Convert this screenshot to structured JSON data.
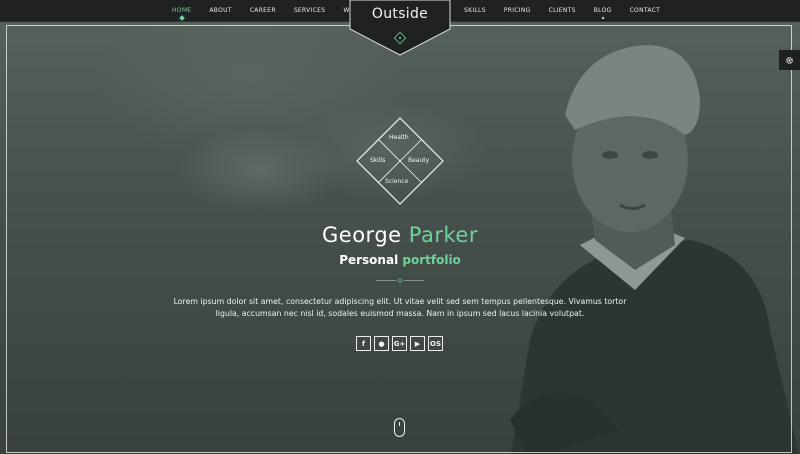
{
  "brand": {
    "logo_text": "Outside"
  },
  "nav_left": [
    "HOME",
    "ABOUT",
    "CAREER",
    "SERVICES",
    "WORKS"
  ],
  "nav_right": [
    "SKILLS",
    "PRICING",
    "CLIENTS",
    "BLOG",
    "CONTACT"
  ],
  "active_nav": "HOME",
  "diamond": {
    "top": "Health",
    "left": "Skills",
    "right": "Beauty",
    "bottom": "Science"
  },
  "hero": {
    "first_name": "George",
    "last_name": "Parker",
    "subtitle_plain": "Personal",
    "subtitle_accent": "portfolio",
    "body": "Lorem ipsum dolor sit amet, consectetur adipiscing elit. Ut vitae velit sed sem tempus pellentesque. Vivamus tortor ligula, accumsan nec nisl id, sodales euismod massa. Nam in ipsum sed lacus lacinia volutpat."
  },
  "socials": [
    {
      "icon": "facebook-icon",
      "glyph": "f"
    },
    {
      "icon": "github-icon",
      "glyph": "●"
    },
    {
      "icon": "google-plus-icon",
      "glyph": "G+"
    },
    {
      "icon": "youtube-icon",
      "glyph": "▶"
    },
    {
      "icon": "os-icon",
      "glyph": "OS"
    }
  ],
  "colors": {
    "accent": "#6ed39a",
    "bar": "#1f2221",
    "text": "#ffffff"
  }
}
